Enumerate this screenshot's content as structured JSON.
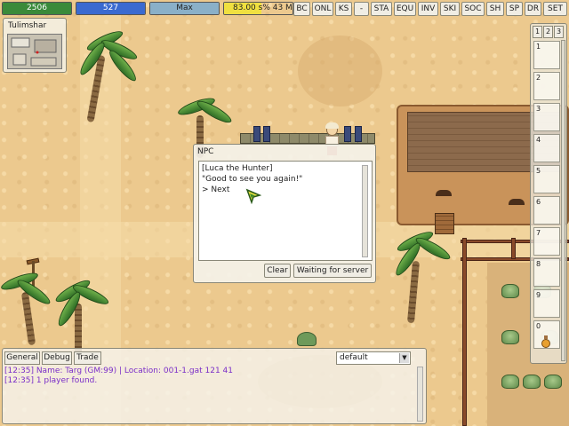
{
  "status": {
    "hp": {
      "value": "2506",
      "fraction": 1.0,
      "color": "#3a8a3a"
    },
    "mp": {
      "value": "527",
      "fraction": 1.0,
      "color": "#3a6ad0"
    },
    "xp": {
      "value": "Max",
      "fraction": 1.0,
      "color": "#8ab0c8"
    },
    "job": {
      "value": "83.00 s% 43 M",
      "fraction": 0.55,
      "color": "#f0e040"
    }
  },
  "toolbar": {
    "buttons": [
      "BC",
      "ONL",
      "KS",
      "-",
      "STA",
      "EQU",
      "INV",
      "SKI",
      "SOC",
      "SH",
      "SP",
      "DR",
      "SET"
    ]
  },
  "minimap": {
    "title": "Tulimshar"
  },
  "shortcuts": {
    "tabs": [
      "1",
      "2",
      "3"
    ],
    "slots": [
      "1",
      "2",
      "3",
      "4",
      "5",
      "6",
      "7",
      "8",
      "9",
      "0"
    ]
  },
  "npc_dialog": {
    "title": "NPC",
    "lines": [
      "[Luca the Hunter]",
      "\"Good to see you again!\"",
      "> Next"
    ],
    "clear_label": "Clear",
    "wait_label": "Waiting for server"
  },
  "chat": {
    "tabs": [
      "General",
      "Debug",
      "Trade"
    ],
    "channel": "default",
    "log": [
      "[12:35] Name: Targ (GM:99) | Location: 001-1.gat 121 41",
      "[12:35] 1 player found."
    ]
  },
  "colors": {
    "chat_text": "#7a2ec8",
    "panel_bg": "#f5f3eb",
    "sand": "#ecc98e"
  }
}
